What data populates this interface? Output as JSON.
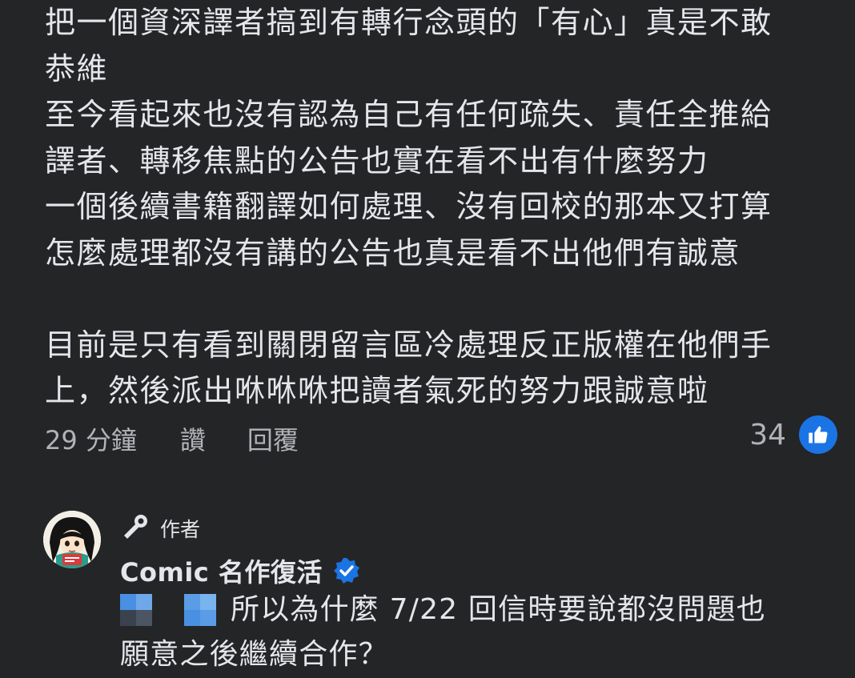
{
  "comment": {
    "lines": [
      "把一個資深譯者搞到有轉行念頭的「有心」真是不敢",
      "恭維",
      "至今看起來也沒有認為自己有任何疏失、責任全推給",
      "譯者、轉移焦點的公告也實在看不出有什麼努力",
      "一個後續書籍翻譯如何處理、沒有回校的那本又打算",
      "怎麼處理都沒有講的公告也真是看不出他們有誠意",
      "",
      "目前是只有看到關閉留言區冷處理反正版權在他們手",
      "上，然後派出咻咻咻把讀者氣死的努力跟誠意啦"
    ],
    "time": "29 分鐘",
    "like_label": "讚",
    "reply_label": "回覆",
    "reaction_count": "34",
    "reaction_icon": "thumbs-up-icon"
  },
  "reply": {
    "badge_label": "作者",
    "badge_icon": "microphone-icon",
    "author_name": "Comic 名作復活",
    "verified_icon": "verified-badge-icon",
    "mention_icon": "blurred-mention-icon",
    "line1": "所以為什麼 7/22 回信時要說都沒問題也",
    "line2": "願意之後繼續合作？"
  },
  "colors": {
    "background": "#242527",
    "text_primary": "#e4e6eb",
    "text_secondary": "#b0b3b8",
    "accent_blue": "#1b74e4"
  }
}
